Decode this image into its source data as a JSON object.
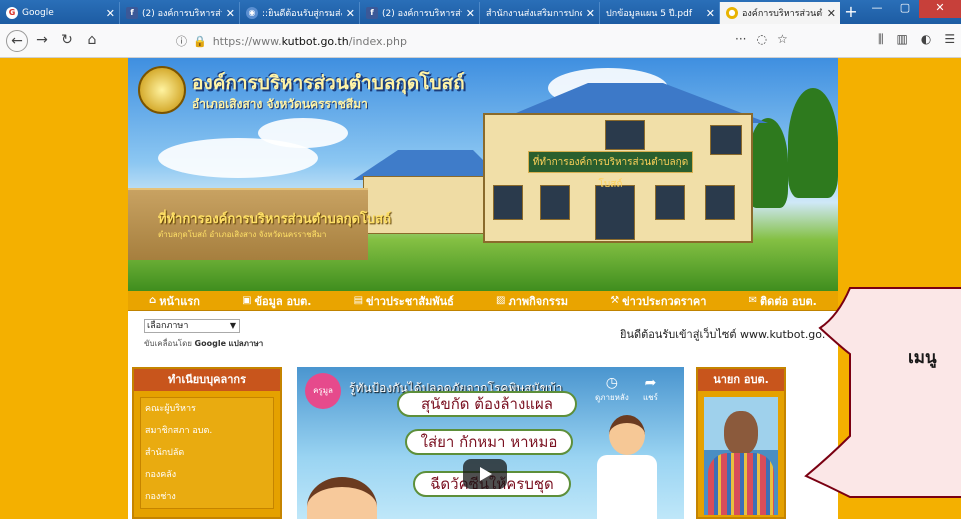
{
  "browser": {
    "tabs": [
      {
        "label": "Google",
        "favicon": "google-icon",
        "active": false
      },
      {
        "label": "(2) องค์การบริหารส่วน",
        "favicon": "facebook-icon",
        "active": false
      },
      {
        "label": "::ยินดีต้อนรับสู่กรมส่งเ",
        "favicon": "globe-icon",
        "active": false
      },
      {
        "label": "(2) องค์การบริหารส่วน",
        "favicon": "facebook-icon",
        "active": false
      },
      {
        "label": "สำนักงานส่งเสริมการปกครอ",
        "favicon": "",
        "active": false
      },
      {
        "label": "ปกข้อมูลแผน 5 ปี.pdf",
        "favicon": "",
        "active": false
      },
      {
        "label": "องค์การบริหารส่วนตำ",
        "favicon": "site-icon",
        "active": true
      }
    ],
    "url": {
      "prefix": "https://www.",
      "domain": "kutbot.go.th",
      "path": "/index.php"
    }
  },
  "site": {
    "title": "องค์การบริหารส่วนตำบลกุดโบสถ์",
    "subtitle": "อำเภอเสิงสาง จังหวัดนครราชสีมา",
    "sign_text": "ที่ทำการองค์การบริหารส่วนตำบลกุดโบสถ์",
    "gate_text": "ที่ทำการองค์การบริหารส่วนตำบลกุดโบสถ์",
    "gate_sub": "ตำบลกุดโบสถ์   อำเภอเสิงสาง   จังหวัดนครราชสีมา"
  },
  "menu": [
    {
      "label": "หน้าแรก",
      "icon": "home-icon"
    },
    {
      "label": "ข้อมูล อบต.",
      "icon": "info-icon"
    },
    {
      "label": "ข่าวประชาสัมพันธ์",
      "icon": "news-icon"
    },
    {
      "label": "ภาพกิจกรรม",
      "icon": "image-icon"
    },
    {
      "label": "ข่าวประกวดราคา",
      "icon": "hammer-icon"
    },
    {
      "label": "ติดต่อ อบต.",
      "icon": "mail-icon"
    }
  ],
  "translate": {
    "selected": "เลือกภาษา",
    "powered_by": "ขับเคลื่อนโดย",
    "google": "Google",
    "translate": "แปลภาษา"
  },
  "welcome": "ยินดีต้อนรับเข้าสู่เว็บไซต์ www.kutbot.go.",
  "left_panel": {
    "heading": "ทำเนียบบุคลากร",
    "items": [
      "คณะผู้บริหาร",
      "สมาชิกสภา อบต.",
      "สำนักปลัด",
      "กองคลัง",
      "กองช่าง"
    ]
  },
  "video": {
    "badge": "ครูมูล",
    "title": "รู้ทันป้องกันได้ปลอดภัยจากโรคพิษสุนัขบ้า",
    "captions": [
      "สุนัขกัด ต้องล้างแผล",
      "ใส่ยา กักหมา หาหมอ",
      "ฉีดวัคซีนให้ครบชุด"
    ],
    "watch_later": "ดูภายหลัง",
    "share": "แชร์"
  },
  "right_panel": {
    "heading": "นายก อบต."
  },
  "overlay": {
    "text": "เมนู"
  }
}
